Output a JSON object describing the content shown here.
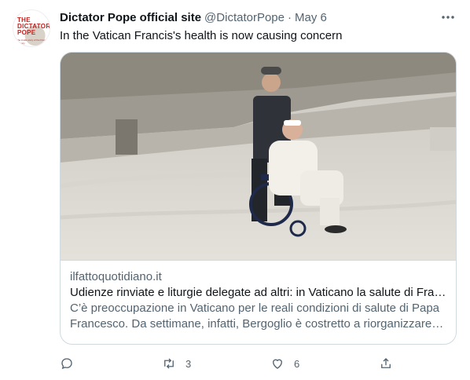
{
  "tweet": {
    "author_name": "Dictator Pope official site",
    "handle": "@DictatorPope",
    "separator": "·",
    "date": "May 6",
    "text": "In the Vatican Francis's health is now causing concern"
  },
  "avatar": {
    "logo_text": "THE DICTATOR POPE",
    "logo_sub": "the inside story of the Francis papacy"
  },
  "card": {
    "domain": "ilfattoquotidiano.it",
    "title": "Udienze rinviate e liturgie delegate ad altri: in Vaticano la salute di Francesco preoccupa",
    "description": "C’è preoccupazione in Vaticano per le reali condizioni di salute di Papa Francesco. Da settimane, infatti, Bergoglio è costretto a riorganizzare la sua agenda"
  },
  "actions": {
    "reply_count": "",
    "retweet_count": "3",
    "like_count": "6",
    "share_count": ""
  },
  "colors": {
    "secondary_text": "#536471",
    "border": "#cfd9de",
    "primary_text": "#0f1419",
    "brand_red": "#c0231f"
  },
  "icons": [
    "more-icon",
    "reply-icon",
    "retweet-icon",
    "like-icon",
    "share-icon"
  ]
}
